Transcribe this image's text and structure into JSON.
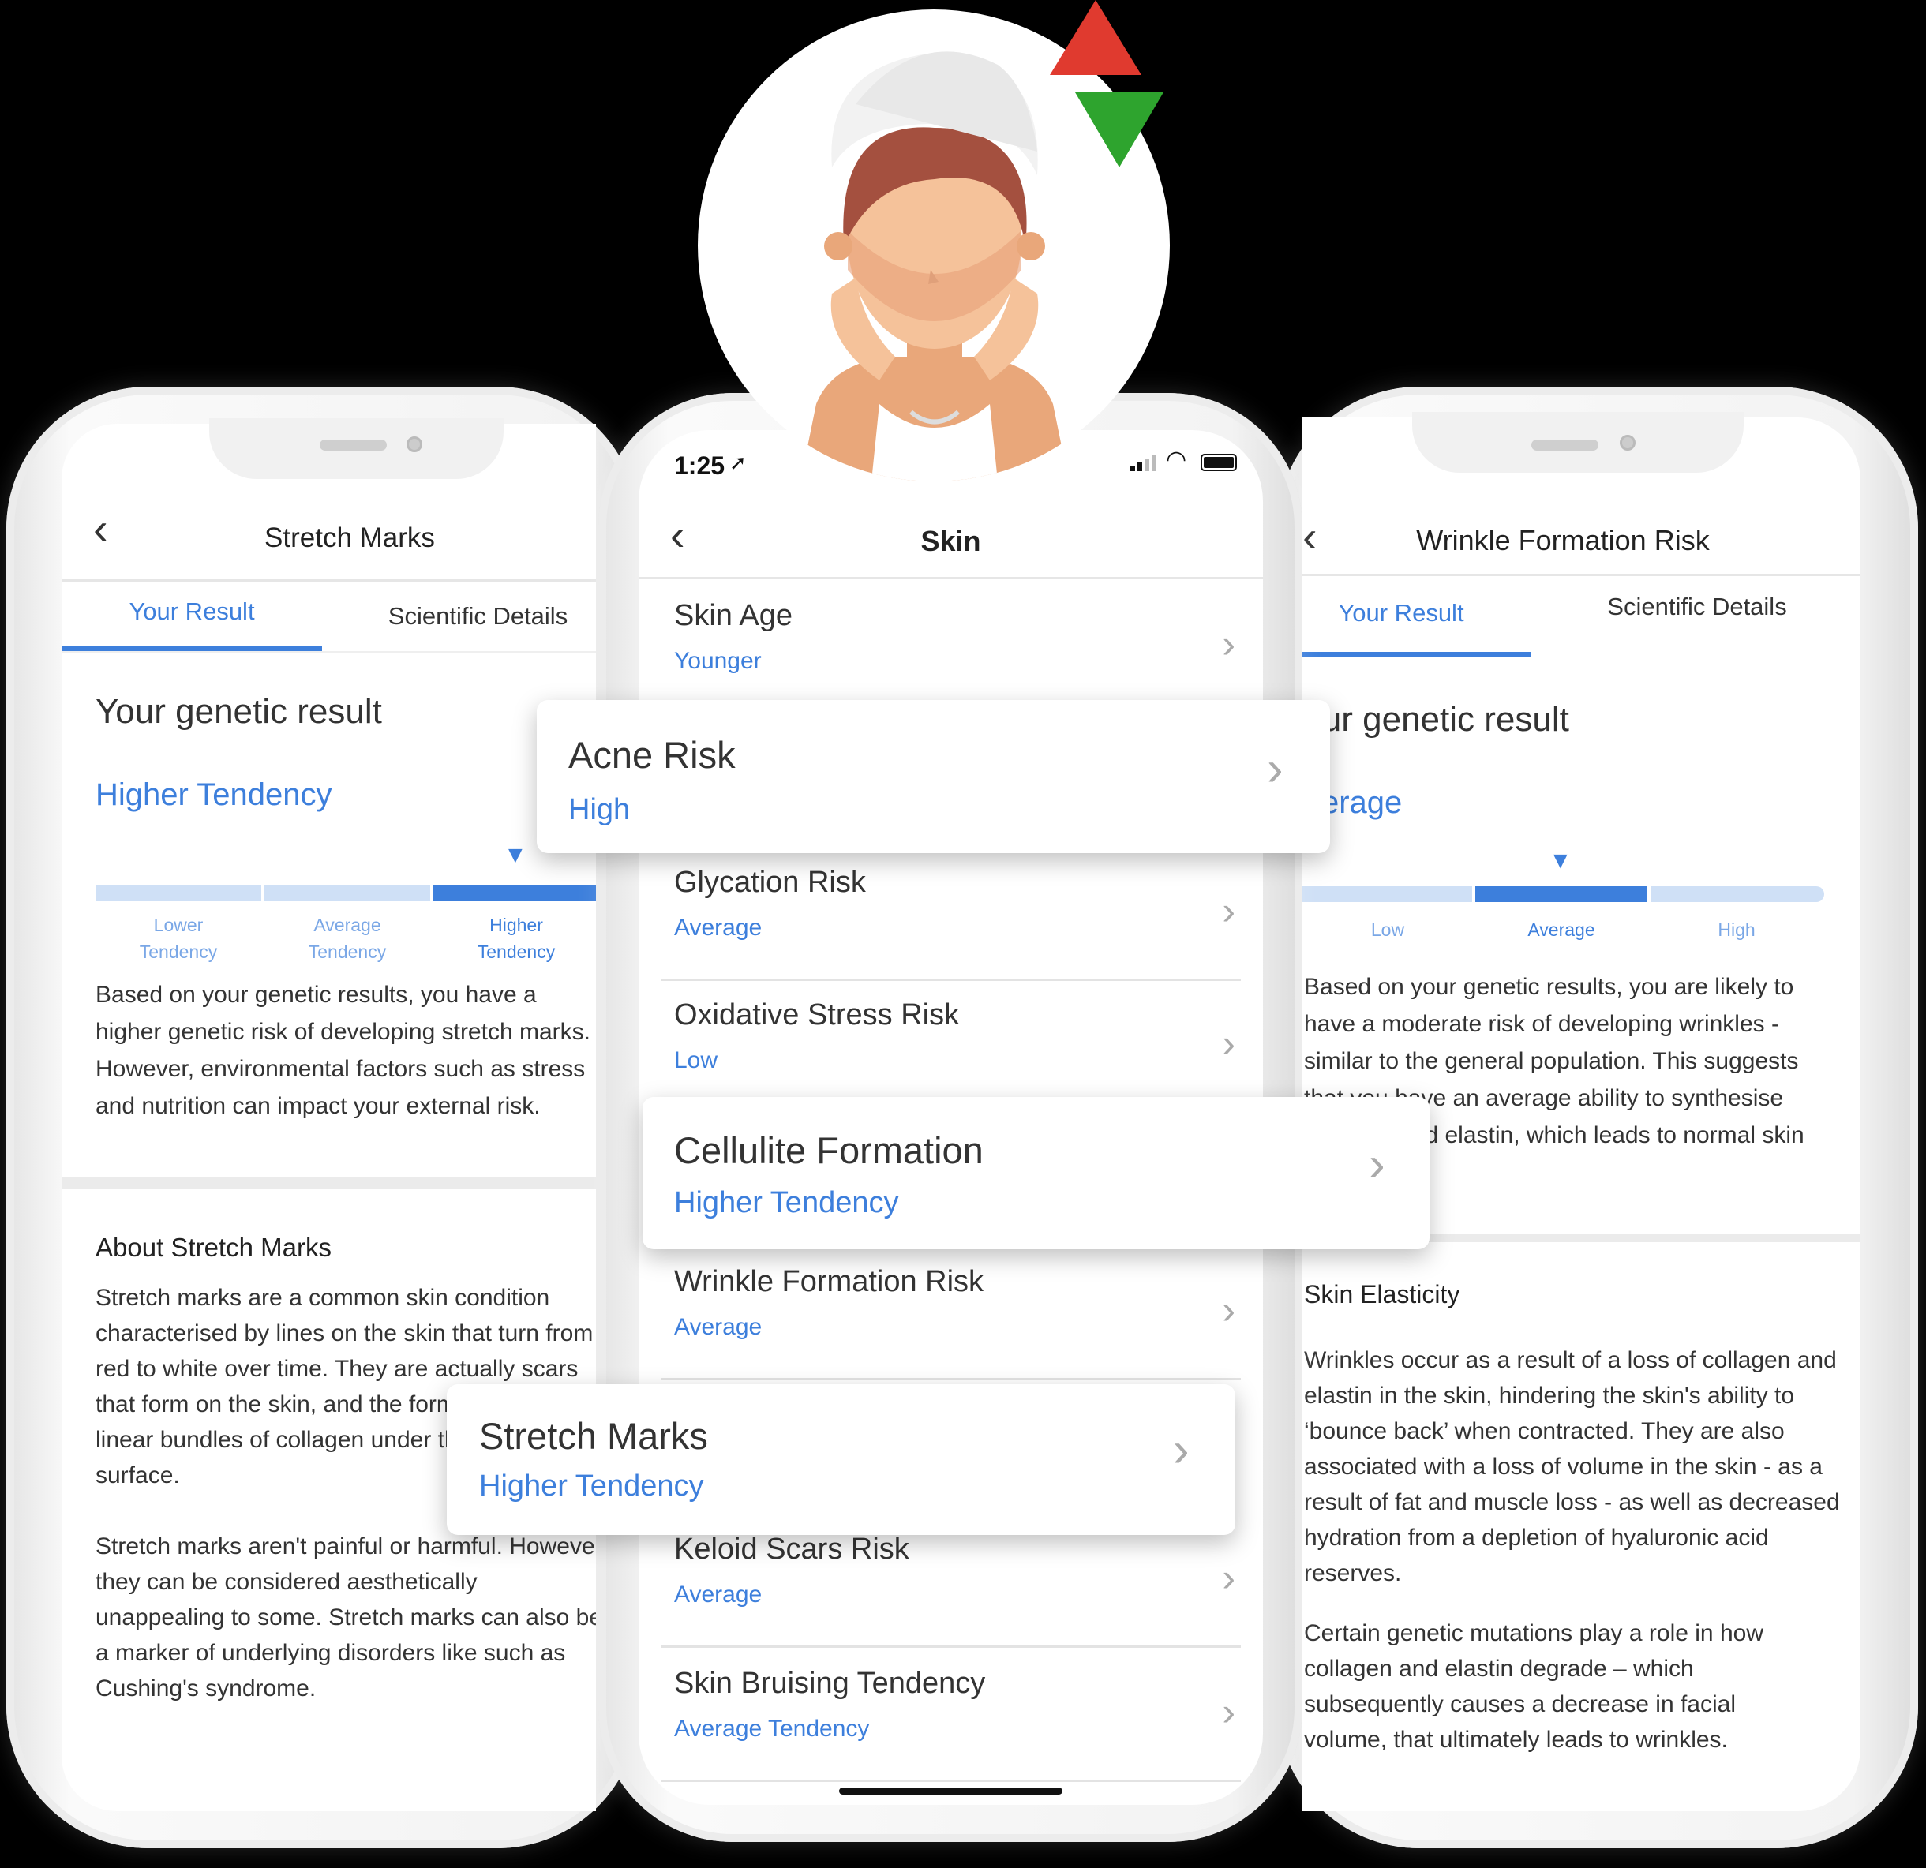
{
  "colors": {
    "accent": "#3d7fdc",
    "bar_light": "#cfe0f6",
    "up_arrow": "#e03a2f",
    "down_arrow": "#2ea42e"
  },
  "icons": {
    "back": "‹",
    "chevron": "›",
    "indicator": "▼"
  },
  "left": {
    "title": "Stretch Marks",
    "tabs": [
      "Your Result",
      "Scientific Details"
    ],
    "active_tab": 0,
    "result_heading": "Your genetic result",
    "result": "Higher Tendency",
    "scale": [
      [
        "Lower",
        "Tendency"
      ],
      [
        "Average",
        "Tendency"
      ],
      [
        "Higher",
        "Tendency"
      ]
    ],
    "scale_level": 3,
    "summary": "Based on your genetic results, you have a higher genetic risk of developing stretch marks. However, environmental factors such as stress and nutrition can impact your external risk.",
    "about_title": "About Stretch Marks",
    "about_p1": "Stretch marks are a common skin condition characterised by lines on the skin that turn from red to white over time. They are actually scars that form on the skin, and the formation is due to linear bundles of collagen under the skin's surface.",
    "about_p2": "Stretch marks aren't painful or harmful. However, they can be considered aesthetically unappealing to some. Stretch marks can also be a marker of underlying disorders like such as Cushing's syndrome."
  },
  "center": {
    "time": "1:25",
    "title": "Skin",
    "rows": [
      {
        "title": "Skin Age",
        "value": "Younger"
      },
      {
        "title": "Acne Risk",
        "value": "High"
      },
      {
        "title": "Glycation Risk",
        "value": "Average"
      },
      {
        "title": "Oxidative Stress Risk",
        "value": "Low"
      },
      {
        "title": "Cellulite Formation",
        "value": "Higher Tendency"
      },
      {
        "title": "Wrinkle Formation Risk",
        "value": "Average"
      },
      {
        "title": "Stretch Marks",
        "value": "Higher Tendency"
      },
      {
        "title": "Keloid Scars Risk",
        "value": "Average"
      },
      {
        "title": "Skin Bruising Tendency",
        "value": "Average Tendency"
      }
    ]
  },
  "right": {
    "title": "Wrinkle Formation Risk",
    "tabs": [
      "Your Result",
      "Scientific Details"
    ],
    "active_tab": 0,
    "result_heading": "Your genetic result",
    "result": "Average",
    "scale": [
      "Low",
      "Average",
      "High"
    ],
    "scale_level": 2,
    "summary": "Based on your genetic results, you are likely to have a moderate risk of developing wrinkles - similar to the general population. This suggests that you have an average ability to synthesise collagen and elastin, which leads to normal skin",
    "about_title": "Skin Elasticity",
    "about_p1": "Wrinkles occur as a result of a loss of collagen and elastin in the skin, hindering the skin's ability to ‘bounce back’ when contracted. They are also associated with a loss of volume in the skin - as a result of fat and muscle loss - as well as decreased hydration from a depletion of hyaluronic acid reserves.",
    "about_p2": "Certain genetic mutations play a role in how collagen and elastin degrade – which subsequently causes a decrease in facial volume, that ultimately leads to wrinkles."
  }
}
